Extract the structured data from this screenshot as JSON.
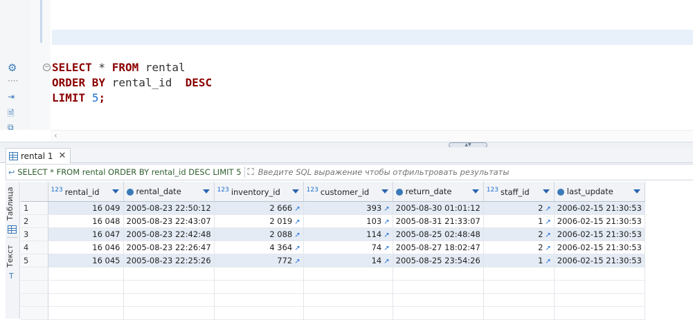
{
  "editor": {
    "lines": [
      {
        "kw1": "SELECT",
        "text1": " * ",
        "kw2": "FROM",
        "text2": " rental"
      },
      {
        "kw1": "ORDER BY",
        "text1": " rental_id  ",
        "kw2": "DESC",
        "text2": ""
      },
      {
        "kw1": "LIMIT",
        "text1": " ",
        "num": "5",
        "text2": ";"
      }
    ]
  },
  "tabs": [
    {
      "label": "rental 1"
    }
  ],
  "filter": {
    "query_text": "SELECT * FROM rental ORDER BY rental_id DESC LIMIT 5",
    "placeholder": "Введите SQL выражение чтобы отфильтровать результаты"
  },
  "side_tabs": {
    "grid": "Таблица",
    "text": "Текст"
  },
  "table": {
    "columns": [
      {
        "name": "rental_id",
        "type": "123"
      },
      {
        "name": "rental_date",
        "type": "clock"
      },
      {
        "name": "inventory_id",
        "type": "123"
      },
      {
        "name": "customer_id",
        "type": "123"
      },
      {
        "name": "return_date",
        "type": "clock"
      },
      {
        "name": "staff_id",
        "type": "123"
      },
      {
        "name": "last_update",
        "type": "clock"
      }
    ],
    "rows": [
      {
        "n": "1",
        "rental_id": "16 049",
        "rental_date": "2005-08-23 22:50:12",
        "inventory_id": "2 666",
        "customer_id": "393",
        "return_date": "2005-08-30 01:01:12",
        "staff_id": "2",
        "last_update": "2006-02-15 21:30:53"
      },
      {
        "n": "2",
        "rental_id": "16 048",
        "rental_date": "2005-08-23 22:43:07",
        "inventory_id": "2 019",
        "customer_id": "103",
        "return_date": "2005-08-31 21:33:07",
        "staff_id": "1",
        "last_update": "2006-02-15 21:30:53"
      },
      {
        "n": "3",
        "rental_id": "16 047",
        "rental_date": "2005-08-23 22:42:48",
        "inventory_id": "2 088",
        "customer_id": "114",
        "return_date": "2005-08-25 02:48:48",
        "staff_id": "2",
        "last_update": "2006-02-15 21:30:53"
      },
      {
        "n": "4",
        "rental_id": "16 046",
        "rental_date": "2005-08-23 22:26:47",
        "inventory_id": "4 364",
        "customer_id": "74",
        "return_date": "2005-08-27 18:02:47",
        "staff_id": "2",
        "last_update": "2006-02-15 21:30:53"
      },
      {
        "n": "5",
        "rental_id": "16 045",
        "rental_date": "2005-08-23 22:25:26",
        "inventory_id": "772",
        "customer_id": "14",
        "return_date": "2005-08-25 23:54:26",
        "staff_id": "1",
        "last_update": "2006-02-15 21:30:53"
      }
    ]
  },
  "colors": {
    "keyword": "#8b0000",
    "number": "#1b6ed1",
    "row_highlight": "#e4ebf4",
    "accent": "#3a7ab8"
  }
}
